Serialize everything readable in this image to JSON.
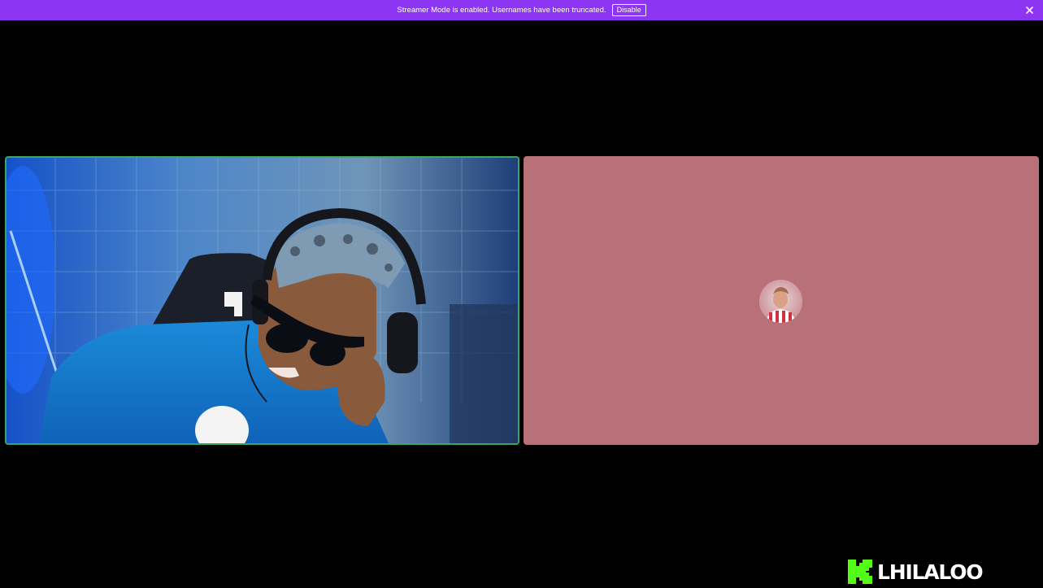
{
  "banner": {
    "message": "Streamer Mode is enabled. Usernames have been truncated.",
    "disable_label": "Disable",
    "close_icon": "close-icon",
    "color": "#8c35f2"
  },
  "call": {
    "left_tile": {
      "type": "video",
      "speaking": true,
      "border_color": "#3ca75a"
    },
    "right_tile": {
      "type": "avatar",
      "background_color": "#b87079",
      "avatar_icon": "user-avatar"
    }
  },
  "watermark": {
    "logo_icon": "kick-logo-icon",
    "name": "LHILALOO",
    "logo_color": "#53fc18"
  }
}
